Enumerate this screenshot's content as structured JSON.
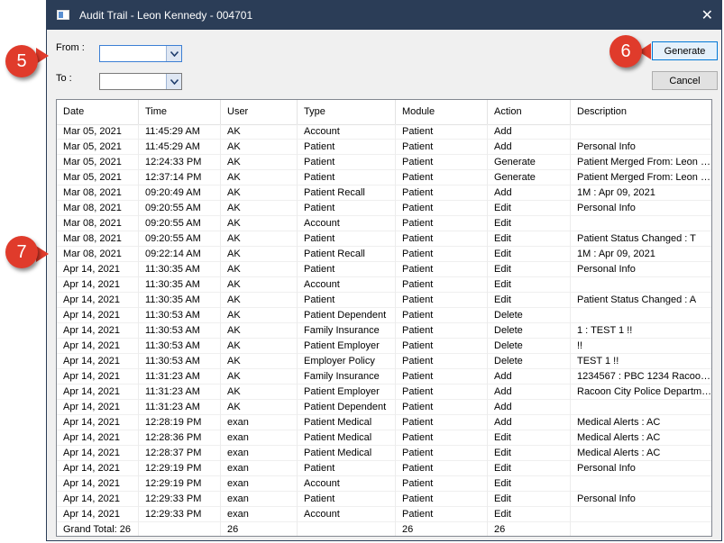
{
  "window": {
    "title": "Audit Trail - Leon Kennedy - 004701"
  },
  "filters": {
    "from_label": "From :",
    "to_label": "To :",
    "from_value": "",
    "to_value": ""
  },
  "buttons": {
    "generate": "Generate",
    "cancel": "Cancel"
  },
  "callouts": [
    "5",
    "6",
    "7"
  ],
  "table": {
    "columns": [
      "Date",
      "Time",
      "User",
      "Type",
      "Module",
      "Action",
      "Description"
    ],
    "rows": [
      [
        "Mar 05, 2021",
        "11:45:29 AM",
        "AK",
        "Account",
        "Patient",
        "Add",
        ""
      ],
      [
        "Mar 05, 2021",
        "11:45:29 AM",
        "AK",
        "Patient",
        "Patient",
        "Add",
        "Personal Info"
      ],
      [
        "Mar 05, 2021",
        "12:24:33 PM",
        "AK",
        "Patient",
        "Patient",
        "Generate",
        "Patient Merged From: Leon K..."
      ],
      [
        "Mar 05, 2021",
        "12:37:14 PM",
        "AK",
        "Patient",
        "Patient",
        "Generate",
        "Patient Merged From: Leon K..."
      ],
      [
        "Mar 08, 2021",
        "09:20:49 AM",
        "AK",
        "Patient Recall",
        "Patient",
        "Add",
        "1M : Apr 09, 2021"
      ],
      [
        "Mar 08, 2021",
        "09:20:55 AM",
        "AK",
        "Patient",
        "Patient",
        "Edit",
        "Personal Info"
      ],
      [
        "Mar 08, 2021",
        "09:20:55 AM",
        "AK",
        "Account",
        "Patient",
        "Edit",
        ""
      ],
      [
        "Mar 08, 2021",
        "09:20:55 AM",
        "AK",
        "Patient",
        "Patient",
        "Edit",
        "Patient Status Changed : T"
      ],
      [
        "Mar 08, 2021",
        "09:22:14 AM",
        "AK",
        "Patient Recall",
        "Patient",
        "Edit",
        "1M : Apr 09, 2021"
      ],
      [
        "Apr 14, 2021",
        "11:30:35 AM",
        "AK",
        "Patient",
        "Patient",
        "Edit",
        "Personal Info"
      ],
      [
        "Apr 14, 2021",
        "11:30:35 AM",
        "AK",
        "Account",
        "Patient",
        "Edit",
        ""
      ],
      [
        "Apr 14, 2021",
        "11:30:35 AM",
        "AK",
        "Patient",
        "Patient",
        "Edit",
        "Patient Status Changed : A"
      ],
      [
        "Apr 14, 2021",
        "11:30:53 AM",
        "AK",
        "Patient Dependent",
        "Patient",
        "Delete",
        ""
      ],
      [
        "Apr 14, 2021",
        "11:30:53 AM",
        "AK",
        "Family Insurance",
        "Patient",
        "Delete",
        "1 : TEST 1 !!"
      ],
      [
        "Apr 14, 2021",
        "11:30:53 AM",
        "AK",
        "Patient Employer",
        "Patient",
        "Delete",
        "!!"
      ],
      [
        "Apr 14, 2021",
        "11:30:53 AM",
        "AK",
        "Employer Policy",
        "Patient",
        "Delete",
        "TEST 1 !!"
      ],
      [
        "Apr 14, 2021",
        "11:31:23 AM",
        "AK",
        "Family Insurance",
        "Patient",
        "Add",
        "1234567 : PBC 1234 Racoon..."
      ],
      [
        "Apr 14, 2021",
        "11:31:23 AM",
        "AK",
        "Patient Employer",
        "Patient",
        "Add",
        "Racoon City Police Department"
      ],
      [
        "Apr 14, 2021",
        "11:31:23 AM",
        "AK",
        "Patient Dependent",
        "Patient",
        "Add",
        ""
      ],
      [
        "Apr 14, 2021",
        "12:28:19 PM",
        "exan",
        "Patient Medical",
        "Patient",
        "Add",
        "Medical Alerts : AC"
      ],
      [
        "Apr 14, 2021",
        "12:28:36 PM",
        "exan",
        "Patient Medical",
        "Patient",
        "Edit",
        "Medical Alerts : AC"
      ],
      [
        "Apr 14, 2021",
        "12:28:37 PM",
        "exan",
        "Patient Medical",
        "Patient",
        "Edit",
        "Medical Alerts : AC"
      ],
      [
        "Apr 14, 2021",
        "12:29:19 PM",
        "exan",
        "Patient",
        "Patient",
        "Edit",
        "Personal Info"
      ],
      [
        "Apr 14, 2021",
        "12:29:19 PM",
        "exan",
        "Account",
        "Patient",
        "Edit",
        ""
      ],
      [
        "Apr 14, 2021",
        "12:29:33 PM",
        "exan",
        "Patient",
        "Patient",
        "Edit",
        "Personal Info"
      ],
      [
        "Apr 14, 2021",
        "12:29:33 PM",
        "exan",
        "Account",
        "Patient",
        "Edit",
        ""
      ]
    ],
    "totals": [
      "Grand Total: 26",
      "",
      "26",
      "",
      "26",
      "26",
      ""
    ]
  }
}
